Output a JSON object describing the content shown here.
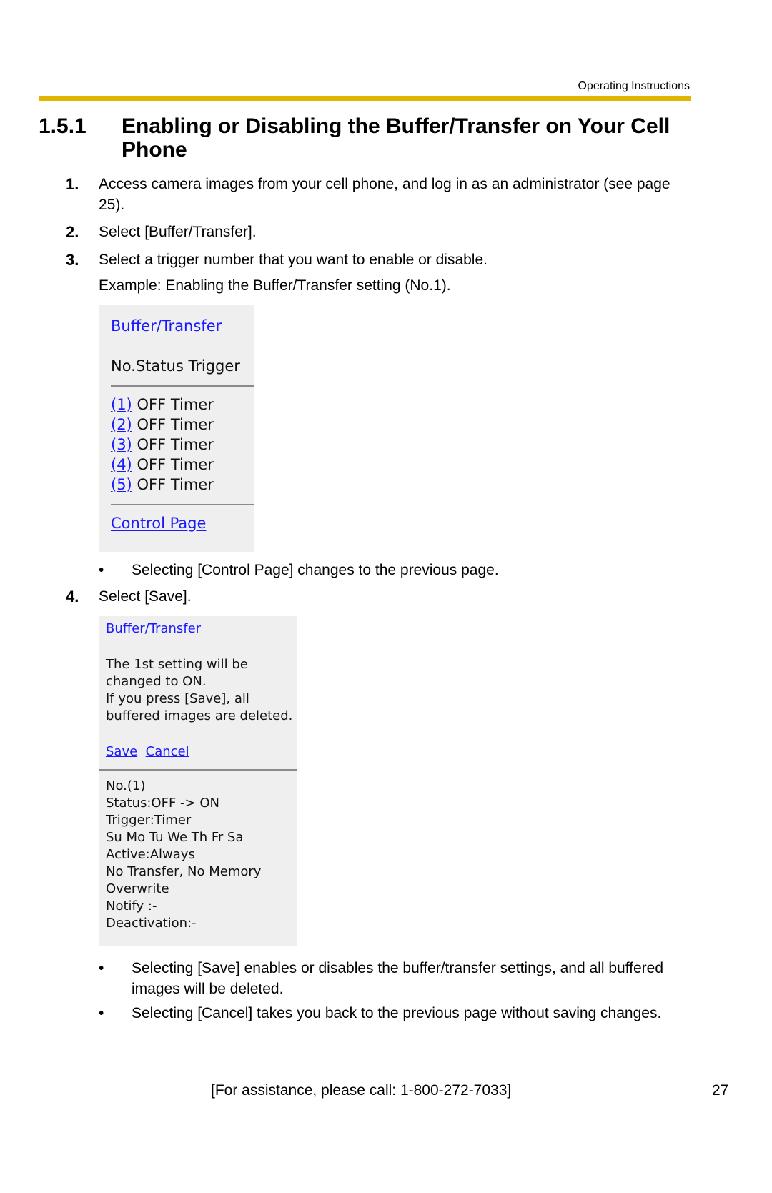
{
  "header": {
    "label": "Operating Instructions",
    "rule_color": "#e0b400"
  },
  "section": {
    "number": "1.5.1",
    "title": "Enabling or Disabling the Buffer/Transfer on Your Cell Phone"
  },
  "steps": [
    {
      "num": "1.",
      "text": "Access camera images from your cell phone, and log in as an administrator (see page 25)."
    },
    {
      "num": "2.",
      "text": "Select [Buffer/Transfer]."
    },
    {
      "num": "3.",
      "text": "Select a trigger number that you want to enable or disable."
    },
    {
      "num": "4.",
      "text": "Select [Save]."
    }
  ],
  "example_text": "Example: Enabling the Buffer/Transfer setting (No.1).",
  "screen1": {
    "title": "Buffer/Transfer",
    "header_row": "No.Status Trigger",
    "rows": [
      {
        "link": "(1)",
        "status": "OFF",
        "trigger": "Timer"
      },
      {
        "link": "(2)",
        "status": "OFF",
        "trigger": "Timer"
      },
      {
        "link": "(3)",
        "status": "OFF",
        "trigger": "Timer"
      },
      {
        "link": "(4)",
        "status": "OFF",
        "trigger": "Timer"
      },
      {
        "link": "(5)",
        "status": "OFF",
        "trigger": "Timer"
      }
    ],
    "control_link": "Control Page"
  },
  "bullet_after_screen1": "Selecting [Control Page] changes to the previous page.",
  "screen2": {
    "title": "Buffer/Transfer",
    "message_lines": [
      "The 1st setting will be",
      "changed to ON.",
      "If you press [Save], all",
      "buffered images are deleted."
    ],
    "save_link": "Save",
    "cancel_link": "Cancel",
    "detail_lines": [
      "No.(1)",
      "Status:OFF -> ON",
      "Trigger:Timer",
      "Su Mo Tu We Th Fr Sa",
      "Active:Always",
      "No Transfer, No Memory",
      "Overwrite",
      "Notify  :-",
      "Deactivation:-"
    ]
  },
  "bullets_after_screen2": [
    "Selecting [Save] enables or disables the buffer/transfer settings, and all buffered images will be deleted.",
    "Selecting [Cancel] takes you back to the previous page without saving changes."
  ],
  "bullet_symbol": "•",
  "footer": {
    "assistance": "[For assistance, please call: 1-800-272-7033]",
    "page_number": "27"
  }
}
